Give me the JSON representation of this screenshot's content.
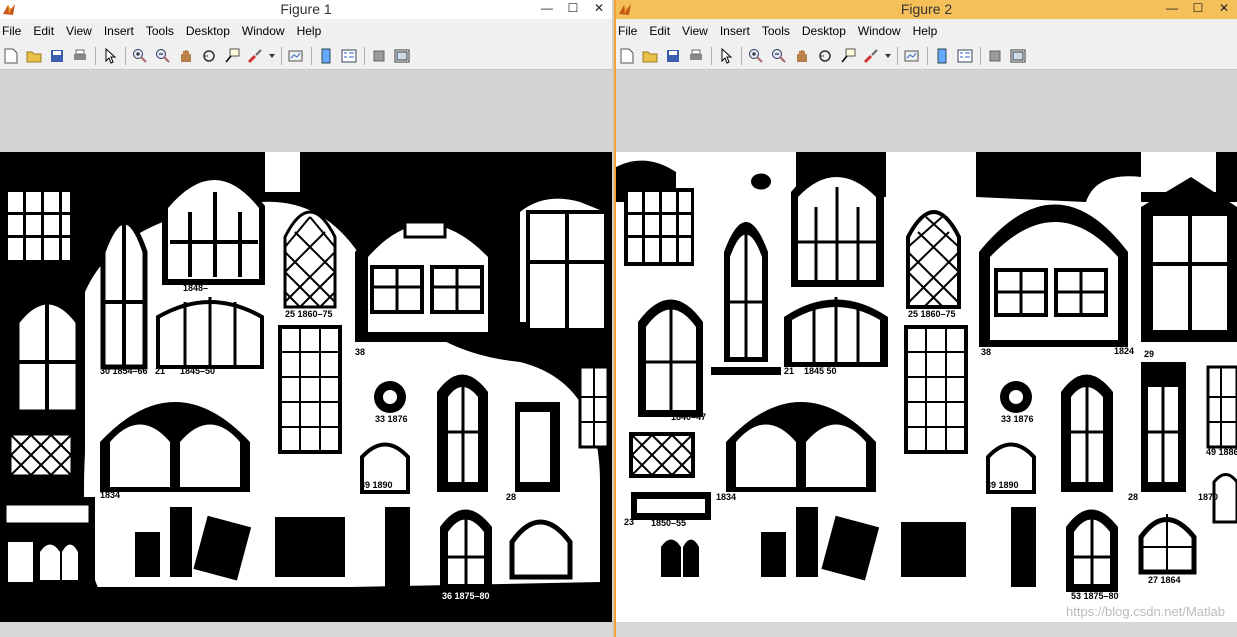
{
  "windows": [
    {
      "title": "Figure 1",
      "controls": [
        "—",
        "☐",
        "✕"
      ],
      "menu": [
        "File",
        "Edit",
        "View",
        "Insert",
        "Tools",
        "Desktop",
        "Window",
        "Help"
      ],
      "labels": [
        "1848–",
        "25  1860–75",
        "38",
        "1834",
        "30  1854–66",
        "21",
        "1845–50",
        "33  1876",
        "39  1890",
        "1834",
        "28",
        "36  1875–80"
      ]
    },
    {
      "title": "Figure 2",
      "controls": [
        "—",
        "☐",
        "✕"
      ],
      "menu": [
        "File",
        "Edit",
        "View",
        "Insert",
        "Tools",
        "Desktop",
        "Window",
        "Help"
      ],
      "labels": [
        "25  1860–75",
        "38",
        "1824",
        "29",
        "21",
        "1845  50",
        "1840–47",
        "33  1876",
        "39  1890",
        "1834",
        "1850–55",
        "23",
        "28",
        "1870",
        "49  1886",
        "27  1864",
        "53  1875–80"
      ]
    }
  ],
  "watermark": "https://blog.csdn.net/Matlab"
}
